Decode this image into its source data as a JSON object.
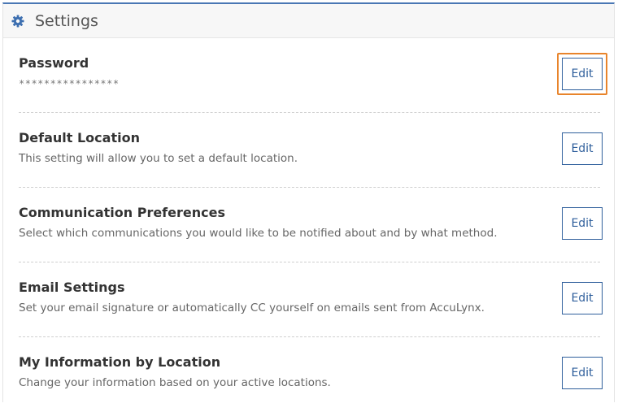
{
  "header": {
    "icon": "gear-icon",
    "title": "Settings",
    "accent_color": "#4a77b4"
  },
  "settings": [
    {
      "label": "Password",
      "description": "****************",
      "masked": true,
      "edit_label": "Edit",
      "focused": true
    },
    {
      "label": "Default Location",
      "description": "This setting will allow you to set a default location.",
      "edit_label": "Edit"
    },
    {
      "label": "Communication Preferences",
      "description": "Select which communications you would like to be notified about and by what method.",
      "edit_label": "Edit"
    },
    {
      "label": "Email Settings",
      "description": "Set your email signature or automatically CC yourself on emails sent from AccuLynx.",
      "edit_label": "Edit"
    },
    {
      "label": "My Information by Location",
      "description": "Change your information based on your active locations.",
      "edit_label": "Edit"
    }
  ],
  "colors": {
    "button_border": "#2f5f9c",
    "focus_ring": "#e8842b"
  }
}
